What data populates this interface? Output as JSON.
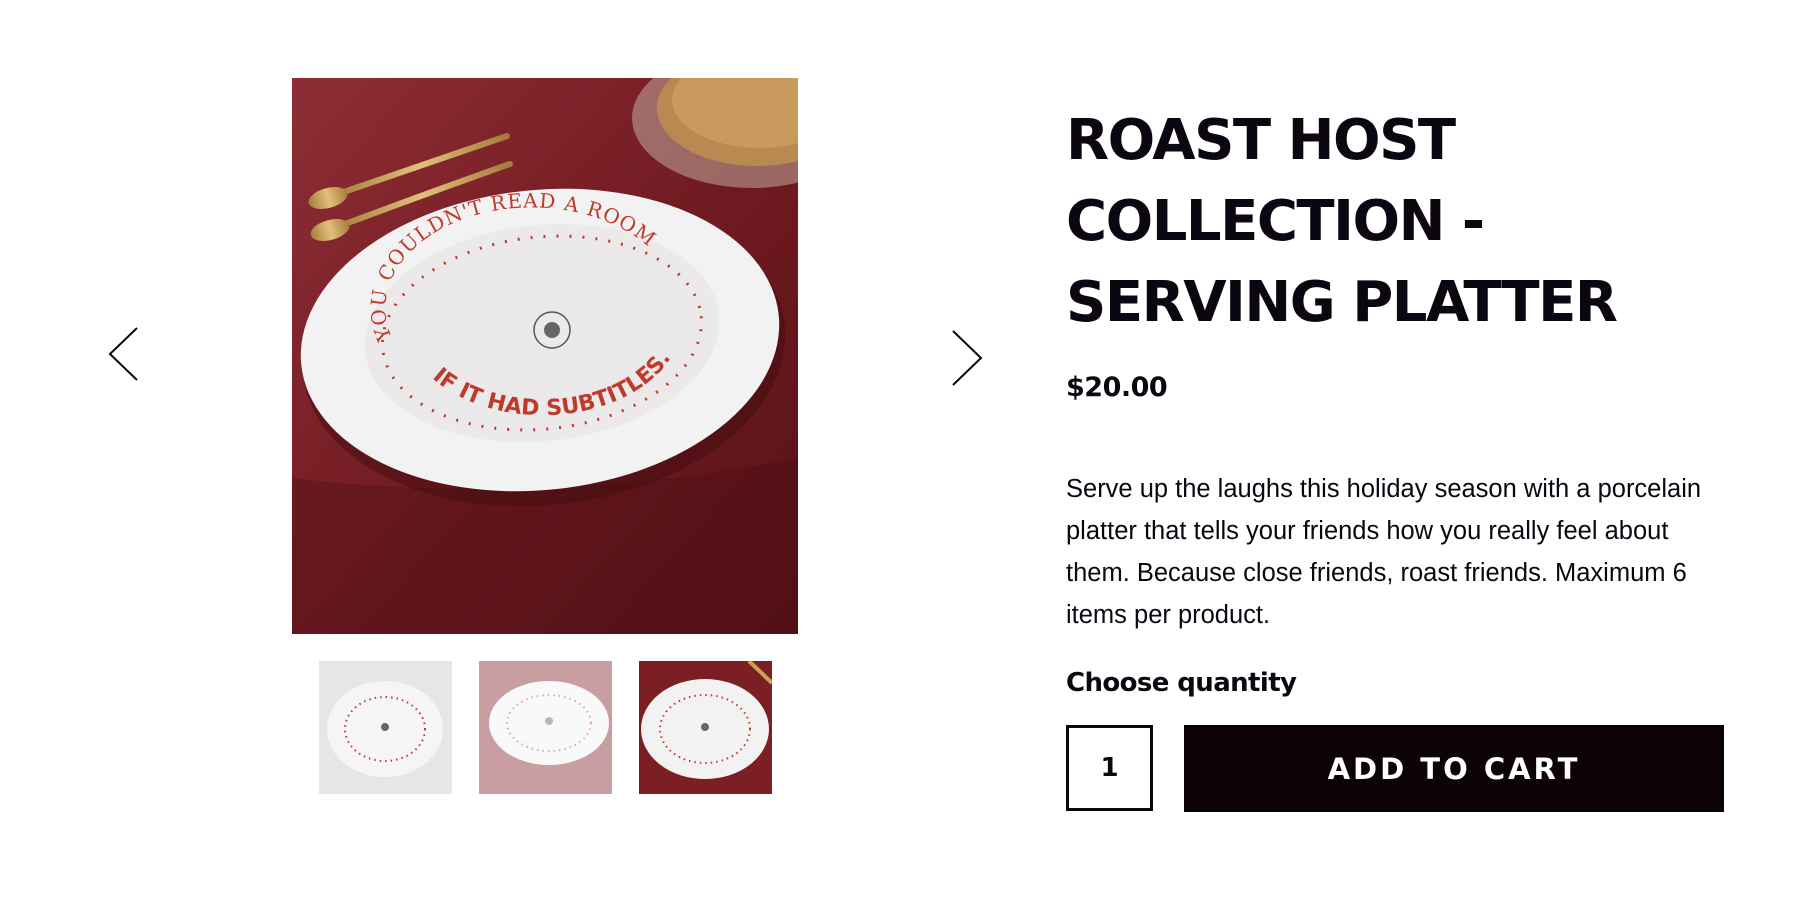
{
  "product": {
    "title": "ROAST HOST COLLECTION - SERVING PLATTER",
    "price": "$20.00",
    "description": "Serve up the laughs this holiday season with a porcelain platter that tells your friends how you really feel about them. Because close friends, roast friends. Maximum 6 items per product."
  },
  "gallery": {
    "prev_icon": "chevron-left-icon",
    "next_icon": "chevron-right-icon",
    "active_thumbnail": 3,
    "plate_text_top": "YOU COULDN'T READ A ROOM",
    "plate_text_bottom": "IF IT HAD SUBTITLES."
  },
  "purchase": {
    "quantity_label": "Choose quantity",
    "quantity_value": "1",
    "add_to_cart_label": "ADD TO CART"
  },
  "colors": {
    "text": "#0c0610",
    "button_bg": "#0c0208",
    "tablecloth": "#7b1f24",
    "plate_print": "#c0392b"
  }
}
